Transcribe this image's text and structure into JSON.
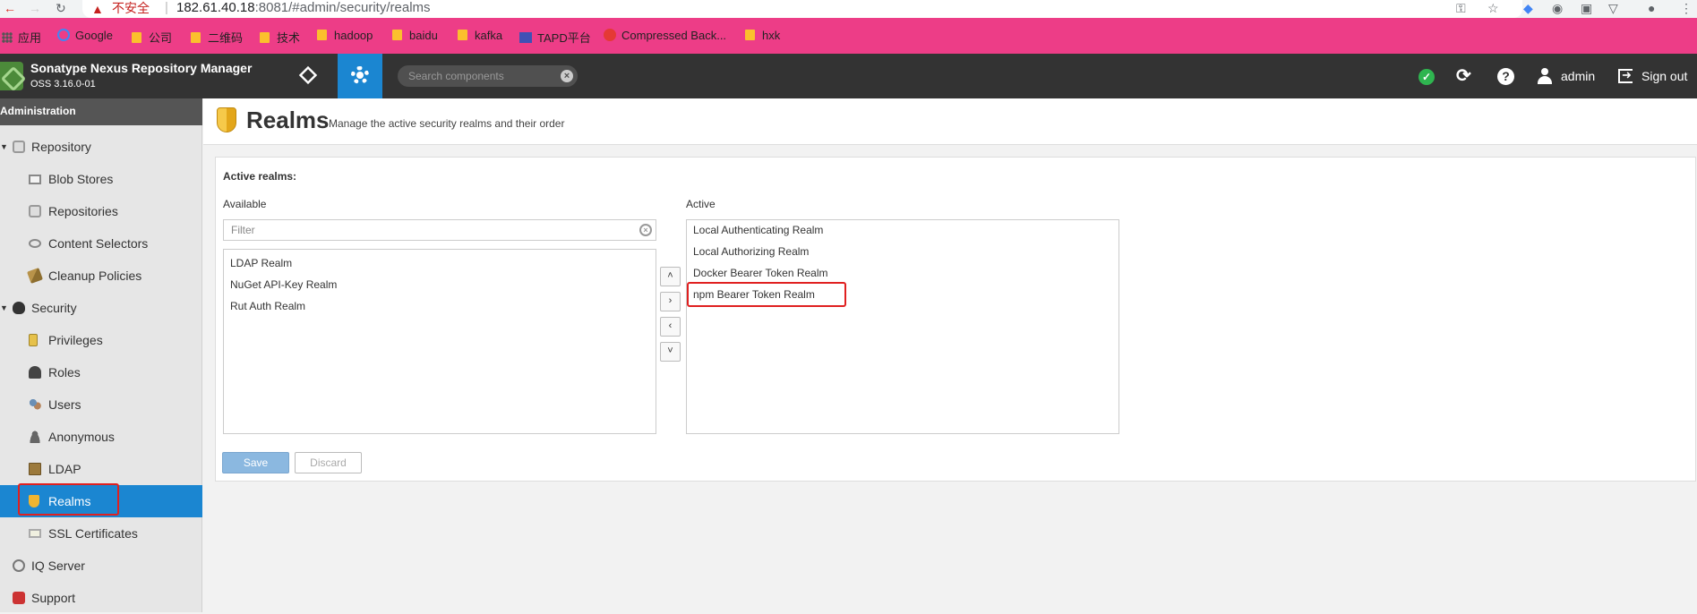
{
  "browser": {
    "insecure_label": "不安全",
    "url_host": "182.61.40.18",
    "url_rest": ":8081/#admin/security/realms",
    "bookmarks": [
      "应用",
      "Google",
      "公司",
      "二维码",
      "技术",
      "hadoop",
      "baidu",
      "kafka",
      "TAPD平台",
      "Compressed Back...",
      "hxk"
    ]
  },
  "header": {
    "app_title": "Sonatype Nexus Repository Manager",
    "version": "OSS 3.16.0-01",
    "search_placeholder": "Search components",
    "user": "admin",
    "signout": "Sign out"
  },
  "sidebar": {
    "title": "Administration",
    "items": [
      {
        "label": "Repository",
        "icon": "database-icon",
        "level": 1
      },
      {
        "label": "Blob Stores",
        "icon": "blob-store-icon",
        "level": 2
      },
      {
        "label": "Repositories",
        "icon": "database-icon",
        "level": 2
      },
      {
        "label": "Content Selectors",
        "icon": "content-selector-icon",
        "level": 2
      },
      {
        "label": "Cleanup Policies",
        "icon": "broom-icon",
        "level": 2
      },
      {
        "label": "Security",
        "icon": "security-icon",
        "level": 1
      },
      {
        "label": "Privileges",
        "icon": "medal-icon",
        "level": 2
      },
      {
        "label": "Roles",
        "icon": "role-icon",
        "level": 2
      },
      {
        "label": "Users",
        "icon": "users-icon",
        "level": 2
      },
      {
        "label": "Anonymous",
        "icon": "anonymous-icon",
        "level": 2
      },
      {
        "label": "LDAP",
        "icon": "book-icon",
        "level": 2
      },
      {
        "label": "Realms",
        "icon": "shield-icon",
        "level": 2,
        "selected": true
      },
      {
        "label": "SSL Certificates",
        "icon": "certificate-icon",
        "level": 2
      },
      {
        "label": "IQ Server",
        "icon": "iq-server-icon",
        "level": 1
      },
      {
        "label": "Support",
        "icon": "support-icon",
        "level": 1
      }
    ]
  },
  "page": {
    "title": "Realms",
    "subtitle": "Manage the active security realms and their order"
  },
  "realms": {
    "heading": "Active realms:",
    "available_label": "Available",
    "active_label": "Active",
    "filter_placeholder": "Filter",
    "available": [
      "LDAP Realm",
      "NuGet API-Key Realm",
      "Rut Auth Realm"
    ],
    "active": [
      "Local Authenticating Realm",
      "Local Authorizing Realm",
      "Docker Bearer Token Realm",
      "npm Bearer Token Realm"
    ],
    "move_buttons": {
      "up": "˄",
      "right": "›",
      "left": "‹",
      "down": "˅"
    },
    "save": "Save",
    "discard": "Discard"
  }
}
